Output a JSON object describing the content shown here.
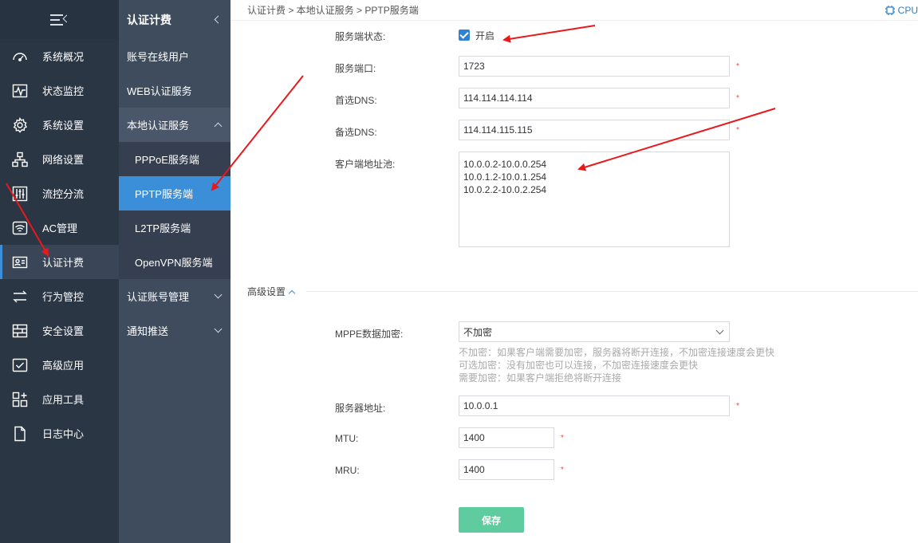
{
  "sidebar": {
    "items": [
      {
        "label": "系统概况",
        "icon": "dashboard-icon"
      },
      {
        "label": "状态监控",
        "icon": "monitor-icon"
      },
      {
        "label": "系统设置",
        "icon": "gear-icon"
      },
      {
        "label": "网络设置",
        "icon": "network-icon"
      },
      {
        "label": "流控分流",
        "icon": "sliders-icon"
      },
      {
        "label": "AC管理",
        "icon": "wifi-icon"
      },
      {
        "label": "认证计费",
        "icon": "id-card-icon",
        "active": true
      },
      {
        "label": "行为管控",
        "icon": "swap-arrows-icon"
      },
      {
        "label": "安全设置",
        "icon": "firewall-icon"
      },
      {
        "label": "高级应用",
        "icon": "check-box-icon"
      },
      {
        "label": "应用工具",
        "icon": "apps-icon"
      },
      {
        "label": "日志中心",
        "icon": "document-icon"
      }
    ]
  },
  "subnav": {
    "title": "认证计费",
    "items": [
      {
        "label": "账号在线用户"
      },
      {
        "label": "WEB认证服务"
      },
      {
        "label": "本地认证服务"
      },
      {
        "label": "PPPoE服务端"
      },
      {
        "label": "PPTP服务端"
      },
      {
        "label": "L2TP服务端"
      },
      {
        "label": "OpenVPN服务端"
      },
      {
        "label": "认证账号管理"
      },
      {
        "label": "通知推送"
      }
    ]
  },
  "breadcrumb": "认证计费 > 本地认证服务 > PPTP服务端",
  "cpu_label": "CPU",
  "form": {
    "status_label": "服务端状态:",
    "status_checkbox_label": "开启",
    "port_label": "服务端口:",
    "port_value": "1723",
    "dns1_label": "首选DNS:",
    "dns1_value": "114.114.114.114",
    "dns2_label": "备选DNS:",
    "dns2_value": "114.114.115.115",
    "pool_label": "客户端地址池:",
    "pool_value": "10.0.0.2-10.0.0.254\n10.0.1.2-10.0.1.254\n10.0.2.2-10.0.2.254"
  },
  "advanced": {
    "title": "高级设置",
    "mppe_label": "MPPE数据加密:",
    "mppe_value": "不加密",
    "help_lines": [
      "不加密：如果客户端需要加密，服务器将断开连接，不加密连接速度会更快",
      "可选加密：没有加密也可以连接，不加密连接速度会更快",
      "需要加密：如果客户端拒绝将断开连接"
    ],
    "server_addr_label": "服务器地址:",
    "server_addr_value": "10.0.0.1",
    "mtu_label": "MTU:",
    "mtu_value": "1400",
    "mru_label": "MRU:",
    "mru_value": "1400"
  },
  "required_mark": "*",
  "save_label": "保存",
  "colors": {
    "sidebar_bg": "#2b3645",
    "subnav_bg": "#3f4c5e",
    "active_blue": "#3b8fd9",
    "save_green": "#5fcca0",
    "annotation_red": "#e8191c"
  }
}
